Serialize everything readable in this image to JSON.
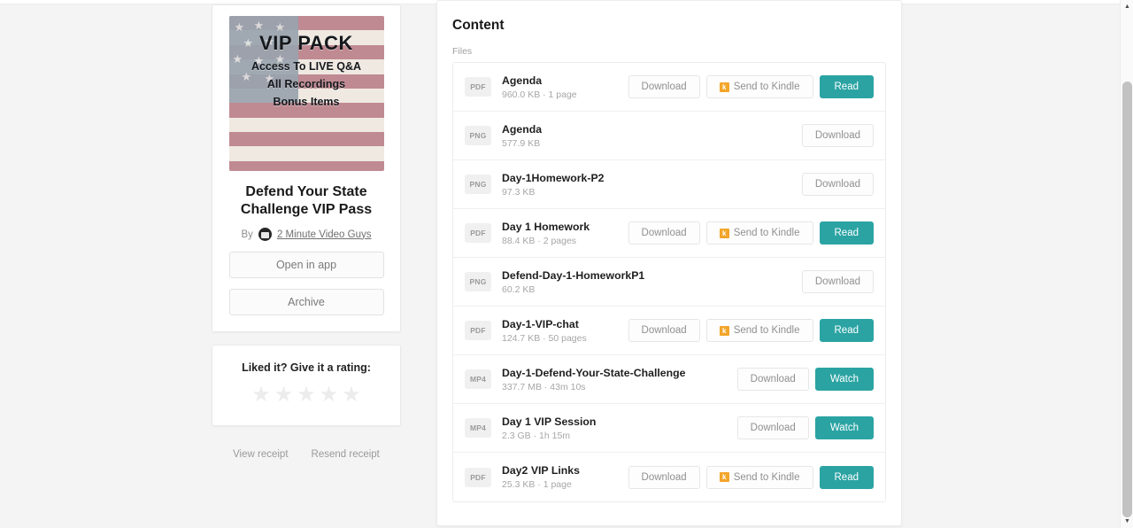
{
  "theme": {
    "accent": "#2ba3a3",
    "page_bg": "#f4f4f4",
    "card_bg": "#ffffff",
    "kindle_orange": "#f3a52a"
  },
  "sidebar": {
    "cover": {
      "title": "VIP PACK",
      "lines": [
        "Access To LIVE Q&A",
        "All Recordings",
        "Bonus Items"
      ]
    },
    "product_title": "Defend Your State Challenge VIP Pass",
    "by_label": "By",
    "author": "2 Minute Video Guys",
    "open_in_app_label": "Open in app",
    "archive_label": "Archive",
    "rating": {
      "prompt": "Liked it? Give it a rating:",
      "stars": 5,
      "filled": 0
    },
    "view_receipt_label": "View receipt",
    "resend_receipt_label": "Resend receipt"
  },
  "main": {
    "title": "Content",
    "files_label": "Files",
    "actions": {
      "download": "Download",
      "send_to_kindle": "Send to Kindle",
      "kindle_glyph": "k",
      "read": "Read",
      "watch": "Watch"
    },
    "files": [
      {
        "type": "PDF",
        "name": "Agenda",
        "meta": "960.0 KB · 1 page",
        "actions": [
          "download",
          "kindle",
          "read"
        ]
      },
      {
        "type": "PNG",
        "name": "Agenda",
        "meta": "577.9 KB",
        "actions": [
          "download"
        ]
      },
      {
        "type": "PNG",
        "name": "Day-1Homework-P2",
        "meta": "97.3 KB",
        "actions": [
          "download"
        ]
      },
      {
        "type": "PDF",
        "name": "Day 1 Homework",
        "meta": "88.4 KB · 2 pages",
        "actions": [
          "download",
          "kindle",
          "read"
        ]
      },
      {
        "type": "PNG",
        "name": "Defend-Day-1-HomeworkP1",
        "meta": "60.2 KB",
        "actions": [
          "download"
        ]
      },
      {
        "type": "PDF",
        "name": "Day-1-VIP-chat",
        "meta": "124.7 KB · 50 pages",
        "actions": [
          "download",
          "kindle",
          "read"
        ]
      },
      {
        "type": "MP4",
        "name": "Day-1-Defend-Your-State-Challenge",
        "meta": "337.7 MB · 43m 10s",
        "actions": [
          "download",
          "watch"
        ]
      },
      {
        "type": "MP4",
        "name": "Day 1 VIP Session",
        "meta": "2.3 GB · 1h 15m",
        "actions": [
          "download",
          "watch"
        ]
      },
      {
        "type": "PDF",
        "name": "Day2 VIP Links",
        "meta": "25.3 KB · 1 page",
        "actions": [
          "download",
          "kindle",
          "read"
        ]
      }
    ]
  },
  "scrollbar": {
    "up_glyph": "▲",
    "down_glyph": "▼"
  }
}
